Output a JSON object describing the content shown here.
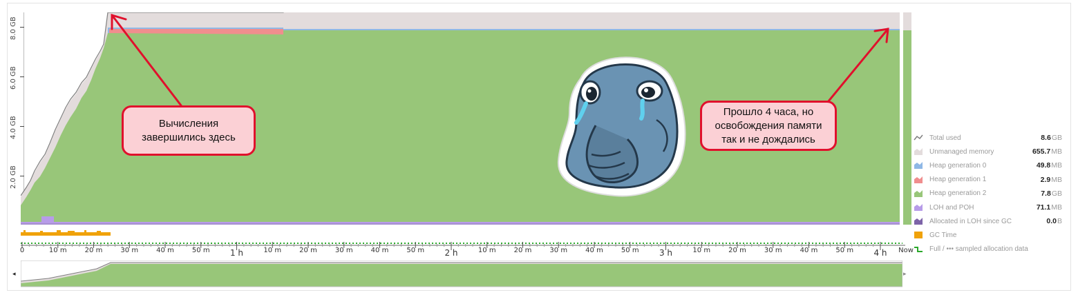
{
  "y_axis": {
    "labels": [
      "8.0 GB",
      "6.0 GB",
      "4.0 GB",
      "2.0 GB"
    ]
  },
  "x_axis": {
    "ticks": [
      {
        "label": "0",
        "major": false
      },
      {
        "label": "10 m",
        "major": false
      },
      {
        "label": "20 m",
        "major": false
      },
      {
        "label": "30 m",
        "major": false
      },
      {
        "label": "40 m",
        "major": false
      },
      {
        "label": "50 m",
        "major": false
      },
      {
        "label": "1 h",
        "major": true
      },
      {
        "label": "10 m",
        "major": false
      },
      {
        "label": "20 m",
        "major": false
      },
      {
        "label": "30 m",
        "major": false
      },
      {
        "label": "40 m",
        "major": false
      },
      {
        "label": "50 m",
        "major": false
      },
      {
        "label": "2 h",
        "major": true
      },
      {
        "label": "10 m",
        "major": false
      },
      {
        "label": "20 m",
        "major": false
      },
      {
        "label": "30 m",
        "major": false
      },
      {
        "label": "40 m",
        "major": false
      },
      {
        "label": "50 m",
        "major": false
      },
      {
        "label": "3 h",
        "major": true
      },
      {
        "label": "10 m",
        "major": false
      },
      {
        "label": "20 m",
        "major": false
      },
      {
        "label": "30 m",
        "major": false
      },
      {
        "label": "40 m",
        "major": false
      },
      {
        "label": "50 m",
        "major": false
      },
      {
        "label": "4 h",
        "major": true
      },
      {
        "label": "Now",
        "major": false
      }
    ]
  },
  "callouts": {
    "left": "Вычисления завершились здесь",
    "right": "Прошло 4 часа, но освобождения памяти так и не дождались"
  },
  "legend": [
    {
      "label": "Total used",
      "number": "8.6",
      "unit": "GB",
      "color": "#7f7f7f",
      "icon": "line-icon"
    },
    {
      "label": "Unmanaged memory",
      "number": "655.7",
      "unit": "MB",
      "color": "#e3dcdc",
      "icon": "area-icon"
    },
    {
      "label": "Heap generation 0",
      "number": "49.8",
      "unit": "MB",
      "color": "#8fb8e6",
      "icon": "area-icon"
    },
    {
      "label": "Heap generation 1",
      "number": "2.9",
      "unit": "MB",
      "color": "#f08e8e",
      "icon": "area-icon"
    },
    {
      "label": "Heap generation 2",
      "number": "7.8",
      "unit": "GB",
      "color": "#98c679",
      "icon": "area-icon"
    },
    {
      "label": "LOH and POH",
      "number": "71.1",
      "unit": "MB",
      "color": "#b79ce8",
      "icon": "area-icon"
    },
    {
      "label": "Allocated in LOH since GC",
      "number": "0.0",
      "unit": "B",
      "color": "#7d64a8",
      "icon": "area-icon"
    },
    {
      "label": "GC Time",
      "number": "",
      "unit": "",
      "color": "#f0a20a",
      "icon": "bar-icon"
    },
    {
      "label": "Full / ••• sampled allocation data",
      "number": "",
      "unit": "",
      "color": "#2aa82a",
      "icon": "step-icon"
    }
  ],
  "navigator": {
    "left_arrow": "◂",
    "right_arrow": "▸"
  },
  "colors": {
    "gen2": "#98c679",
    "unmanaged": "#e3dcdc",
    "gen0": "#8fb8e6",
    "gen1": "#f08e8e",
    "loh": "#b79ce8",
    "total_line": "#7f7f7f",
    "gc_time": "#f0a20a",
    "sampled": "#2aa82a",
    "callout_border": "#e0102c",
    "callout_fill": "#fbd0d5",
    "arrow": "#e0102c"
  }
}
